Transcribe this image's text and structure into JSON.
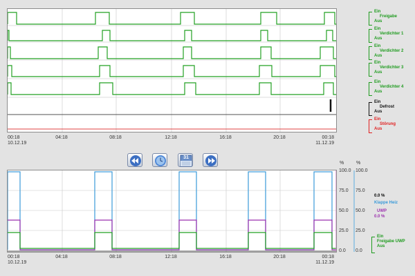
{
  "top_chart": {
    "x_ticks": [
      {
        "time": "00:18",
        "date": "10.12.19"
      },
      {
        "time": "04:18",
        "date": ""
      },
      {
        "time": "08:18",
        "date": ""
      },
      {
        "time": "12:18",
        "date": ""
      },
      {
        "time": "16:18",
        "date": ""
      },
      {
        "time": "20:18",
        "date": ""
      },
      {
        "time": "00:18",
        "date": "11.12.19"
      }
    ],
    "channels": [
      {
        "on": "Ein",
        "name": "Freigabe",
        "off": "Aus",
        "color": "#1e9b1e"
      },
      {
        "on": "Ein",
        "name": "Verdichter 1",
        "off": "Aus",
        "color": "#1e9b1e"
      },
      {
        "on": "Ein",
        "name": "Verdichter 2",
        "off": "Aus",
        "color": "#1e9b1e"
      },
      {
        "on": "Ein",
        "name": "Verdichter 3",
        "off": "Aus",
        "color": "#1e9b1e"
      },
      {
        "on": "Ein",
        "name": "Verdichter 4",
        "off": "Aus",
        "color": "#1e9b1e"
      },
      {
        "on": "Ein",
        "name": "Defrost",
        "off": "Aus",
        "color": "#111111"
      },
      {
        "on": "Ein",
        "name": "Störung",
        "off": "Aus",
        "color": "#e02020"
      }
    ]
  },
  "toolbar": {
    "rewind": "rewind-button",
    "clock": "clock-button",
    "calendar_day": "31",
    "forward": "forward-button"
  },
  "bottom_chart": {
    "x_ticks": [
      {
        "time": "00:18",
        "date": "10.12.19"
      },
      {
        "time": "04:18",
        "date": ""
      },
      {
        "time": "08:18",
        "date": ""
      },
      {
        "time": "12:18",
        "date": ""
      },
      {
        "time": "16:18",
        "date": ""
      },
      {
        "time": "20:18",
        "date": ""
      },
      {
        "time": "00:18",
        "date": "11.12.19"
      }
    ],
    "unit_left": "%",
    "unit_right": "%",
    "y_ticks_left": [
      "100.0",
      "75.0",
      "50.0",
      "25.0",
      "0.0"
    ],
    "y_ticks_right": [
      "100.0",
      "75.0",
      "50.0",
      "25.0",
      "0.0"
    ],
    "klappe_value": "0.0 %",
    "klappe_label": "Klappe Heiz",
    "klappe_color": "#3a9ad9",
    "uwp_label": "UWP",
    "uwp_value": "0.0 %",
    "uwp_color": "#9b2fae",
    "freigabe_on": "Ein",
    "freigabe_label": "Freigabe UWP",
    "freigabe_off": "Aus"
  }
}
